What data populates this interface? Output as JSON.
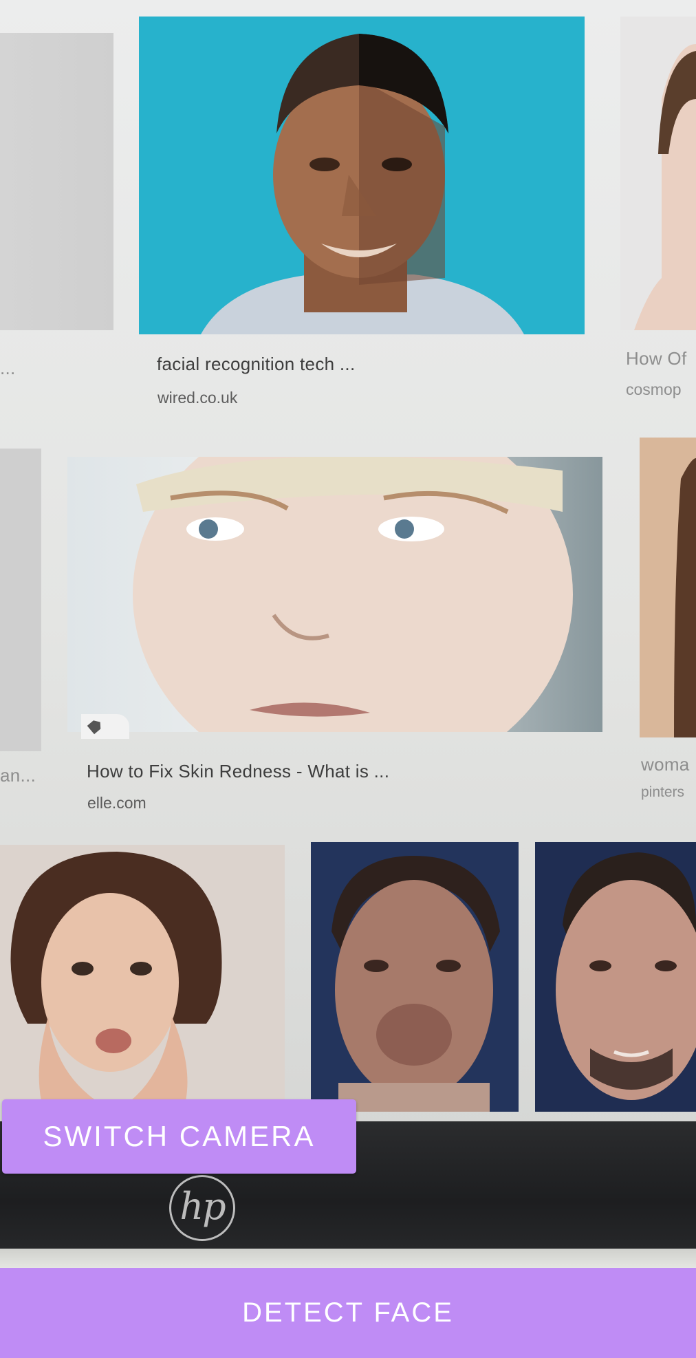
{
  "results": [
    {
      "caption": "facial recognition tech ...",
      "source": "wired.co.uk"
    },
    {
      "caption": "How to Fix Skin Redness - What is ...",
      "source": "elle.com"
    }
  ],
  "partial_captions": {
    "top_left": "...",
    "top_right_title": "How Of",
    "top_right_source": "cosmop",
    "mid_left": "an...",
    "mid_right_title": "woma",
    "mid_right_source": "pinters"
  },
  "laptop_logo": "hp",
  "buttons": {
    "switch_camera": "SWITCH CAMERA",
    "detect_face": "DETECT FACE"
  },
  "colors": {
    "accent": "#bf8cf5",
    "thumb_background_teal": "#27b2cc",
    "bezel": "#1f2022"
  },
  "icons": [
    "tag-icon"
  ]
}
